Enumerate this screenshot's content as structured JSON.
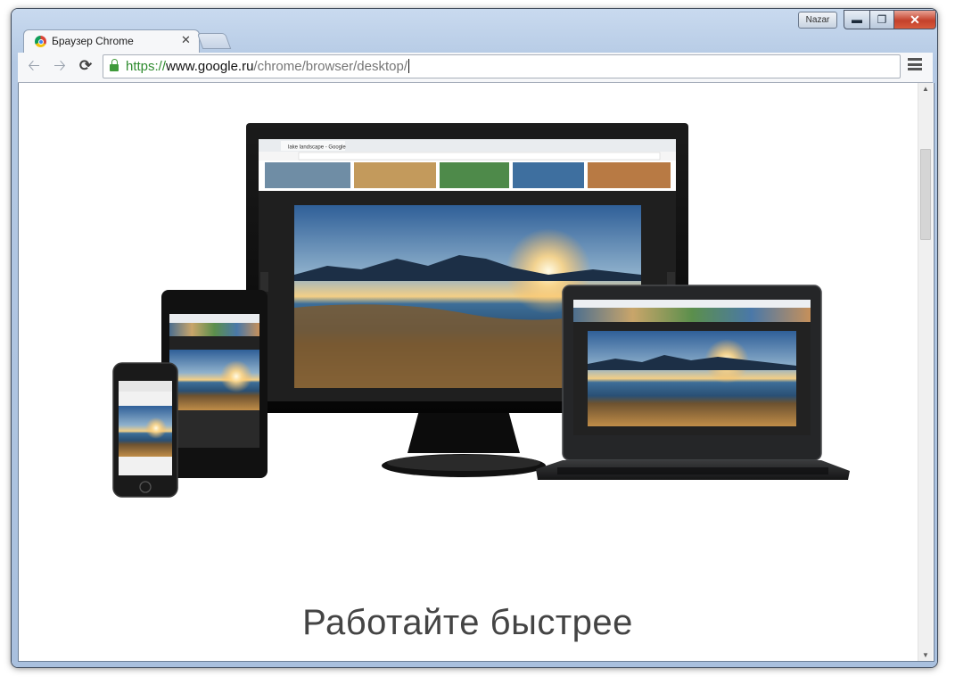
{
  "window": {
    "user_badge": "Nazar",
    "controls": {
      "minimize_icon": "minimize-icon",
      "maximize_icon": "maximize-icon",
      "close_icon": "close-icon"
    }
  },
  "tabs": [
    {
      "title": "Браузер Chrome",
      "active": true,
      "favicon": "chrome-icon"
    }
  ],
  "toolbar": {
    "back_icon": "back-arrow-icon",
    "forward_icon": "forward-arrow-icon",
    "reload_icon": "reload-icon",
    "menu_icon": "hamburger-menu-icon",
    "lock_icon": "lock-icon",
    "url": {
      "scheme": "https://",
      "host": "www.google.ru",
      "path": "/chrome/browser/desktop/"
    },
    "secure_color": "#2e8b2e"
  },
  "page": {
    "hero_image": "devices-illustration",
    "headline": "Работайте быстрее",
    "inner_browser": {
      "tab_title": "lake landscape - Google"
    }
  }
}
